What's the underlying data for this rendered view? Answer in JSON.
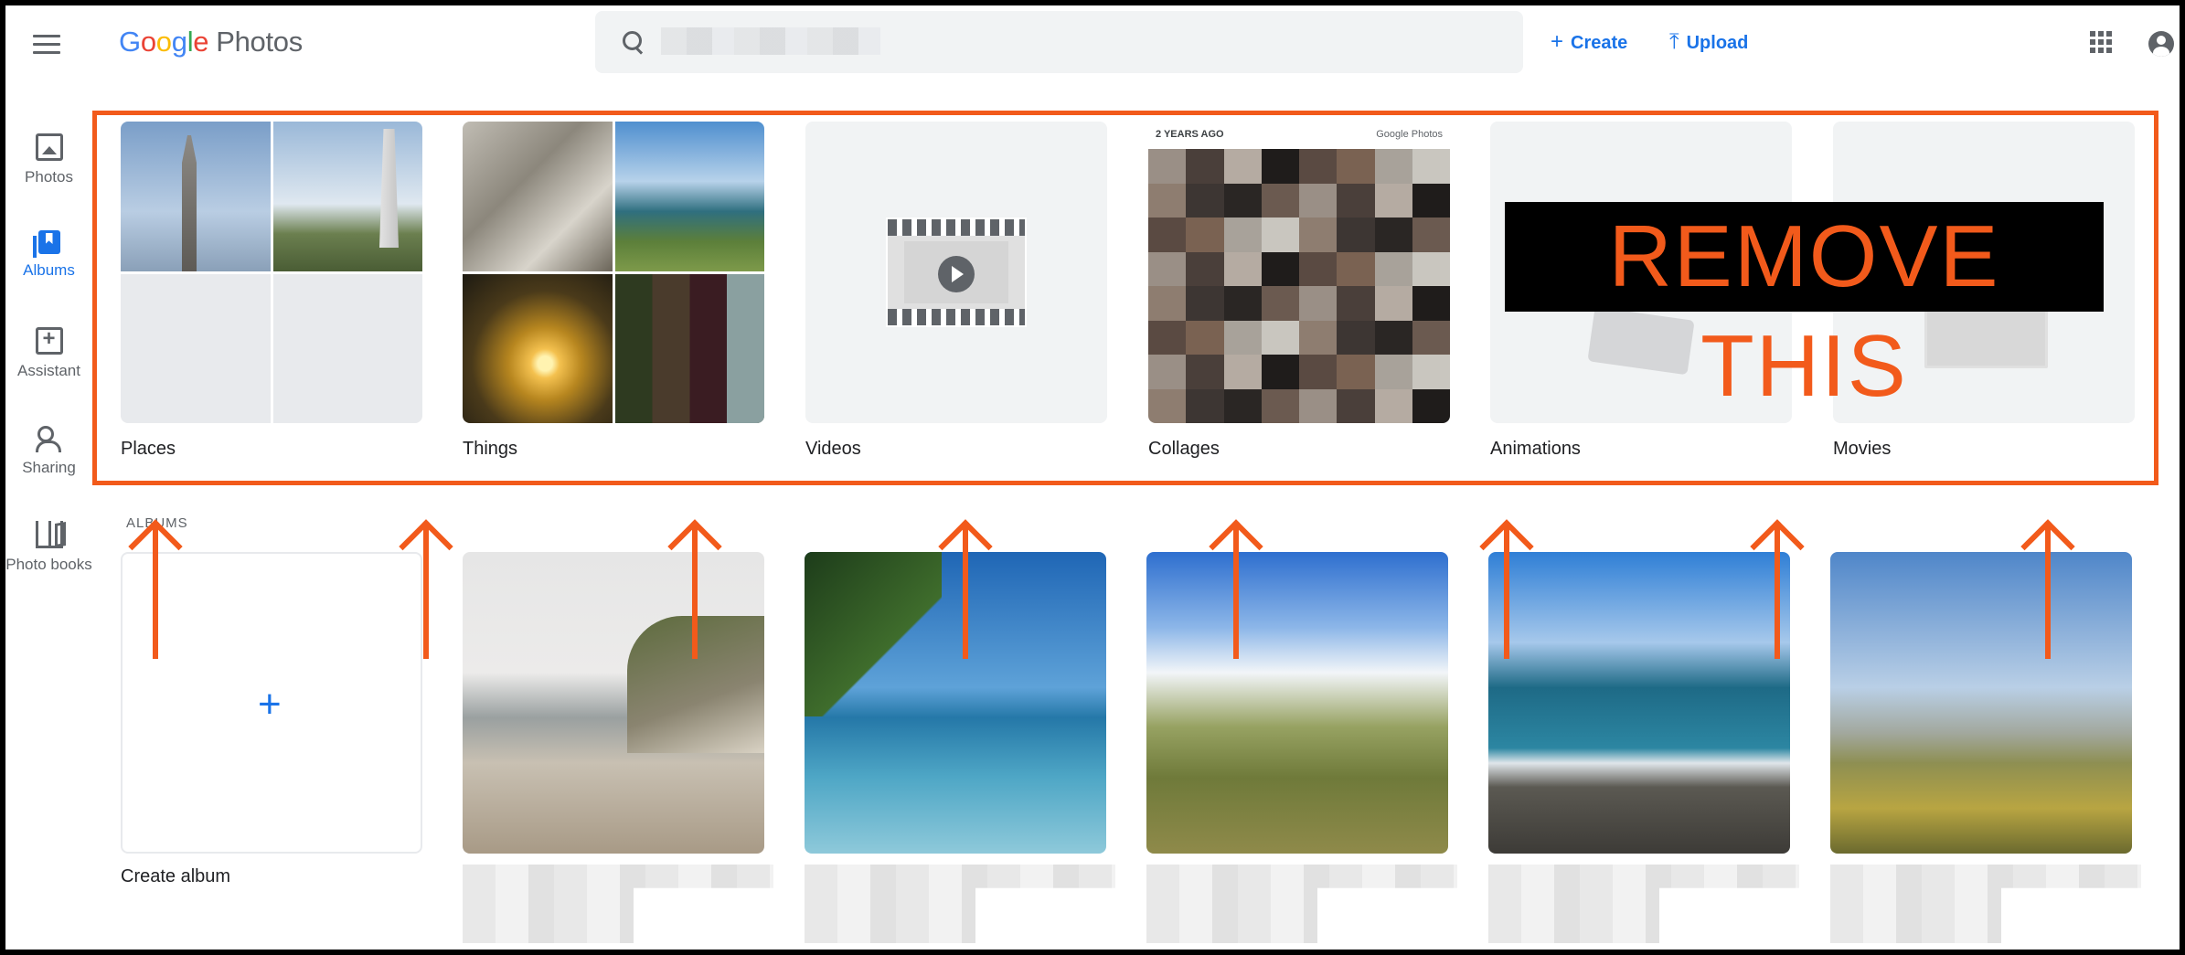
{
  "app": {
    "logo_letters": [
      "G",
      "o",
      "o",
      "g",
      "l",
      "e"
    ],
    "product": "Photos"
  },
  "header": {
    "search": {
      "value": "",
      "placeholder": ""
    },
    "create_label": "Create",
    "upload_label": "Upload"
  },
  "sidebar": {
    "items": [
      {
        "label": "Photos",
        "icon": "photos-icon",
        "active": false
      },
      {
        "label": "Albums",
        "icon": "albums-icon",
        "active": true
      },
      {
        "label": "Assistant",
        "icon": "assistant-icon",
        "active": false
      },
      {
        "label": "Sharing",
        "icon": "sharing-icon",
        "active": false
      },
      {
        "label": "Photo books",
        "icon": "photo-books-icon",
        "active": false
      }
    ]
  },
  "categories": [
    {
      "label": "Places"
    },
    {
      "label": "Things"
    },
    {
      "label": "Videos"
    },
    {
      "label": "Collages",
      "overlay_left": "2 YEARS AGO",
      "overlay_right": "Google Photos"
    },
    {
      "label": "Animations"
    },
    {
      "label": "Movies"
    }
  ],
  "annotation": {
    "text": "REMOVE THIS",
    "color": "#f25a1b"
  },
  "albums": {
    "heading": "ALBUMS",
    "create_label": "Create album",
    "create_icon": "+"
  },
  "colors": {
    "accent": "#1a73e8",
    "annotation": "#f25a1b"
  }
}
